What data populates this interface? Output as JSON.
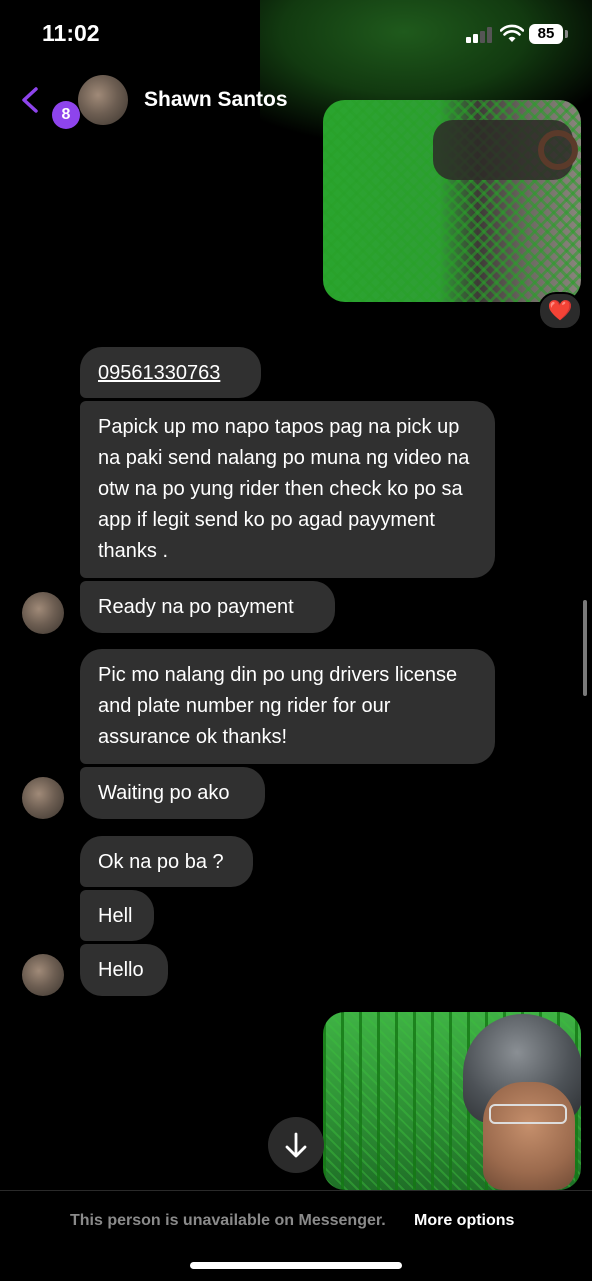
{
  "status_bar": {
    "time": "11:02",
    "battery": "85"
  },
  "header": {
    "unread_count": "8",
    "contact_name": "Shawn Santos"
  },
  "reaction": {
    "emoji": "❤️"
  },
  "messages": [
    {
      "text": "09561330763"
    },
    {
      "text": "Papick up mo napo tapos pag na pick up na  paki send nalang po muna ng video na otw na po yung rider then check ko po sa app if legit send ko po agad payyment thanks ."
    },
    {
      "text": "Ready na po payment"
    },
    {
      "text": "Pic mo nalang din po ung drivers license and plate number ng rider for our assurance ok thanks!"
    },
    {
      "text": "Waiting po ako"
    },
    {
      "text": "Ok na po ba ?"
    },
    {
      "text": "Hell"
    },
    {
      "text": "Hello"
    }
  ],
  "footer": {
    "message": "This person is unavailable on Messenger.",
    "link": "More options"
  },
  "colors": {
    "accent": "#8e44ec",
    "bubble": "#303030",
    "background": "#000000"
  },
  "icons": [
    "back-chevron-icon",
    "signal-icon",
    "wifi-icon",
    "battery-icon",
    "heart-icon",
    "arrow-down-icon"
  ]
}
